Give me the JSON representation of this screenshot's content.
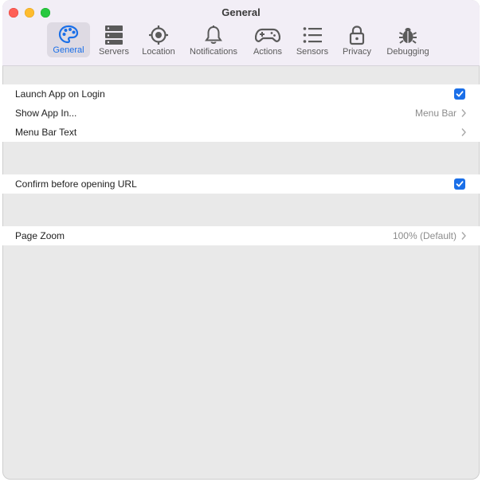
{
  "window": {
    "title": "General"
  },
  "tabs": [
    {
      "label": "General",
      "icon": "palette-icon",
      "active": true
    },
    {
      "label": "Servers",
      "icon": "server-icon"
    },
    {
      "label": "Location",
      "icon": "location-target-icon"
    },
    {
      "label": "Notifications",
      "icon": "bell-icon"
    },
    {
      "label": "Actions",
      "icon": "gamepad-icon"
    },
    {
      "label": "Sensors",
      "icon": "list-icon"
    },
    {
      "label": "Privacy",
      "icon": "lock-icon"
    },
    {
      "label": "Debugging",
      "icon": "bug-icon"
    }
  ],
  "settings": {
    "launch_on_login": {
      "label": "Launch App on Login",
      "checked": true
    },
    "show_app_in": {
      "label": "Show App In...",
      "value": "Menu Bar"
    },
    "menu_bar_text": {
      "label": "Menu Bar Text"
    },
    "confirm_url": {
      "label": "Confirm before opening URL",
      "checked": true
    },
    "page_zoom": {
      "label": "Page Zoom",
      "value": "100% (Default)"
    }
  },
  "colors": {
    "accent": "#1a6fe8",
    "toolbar_bg": "#f2eef6",
    "content_bg": "#e9e9e9"
  }
}
